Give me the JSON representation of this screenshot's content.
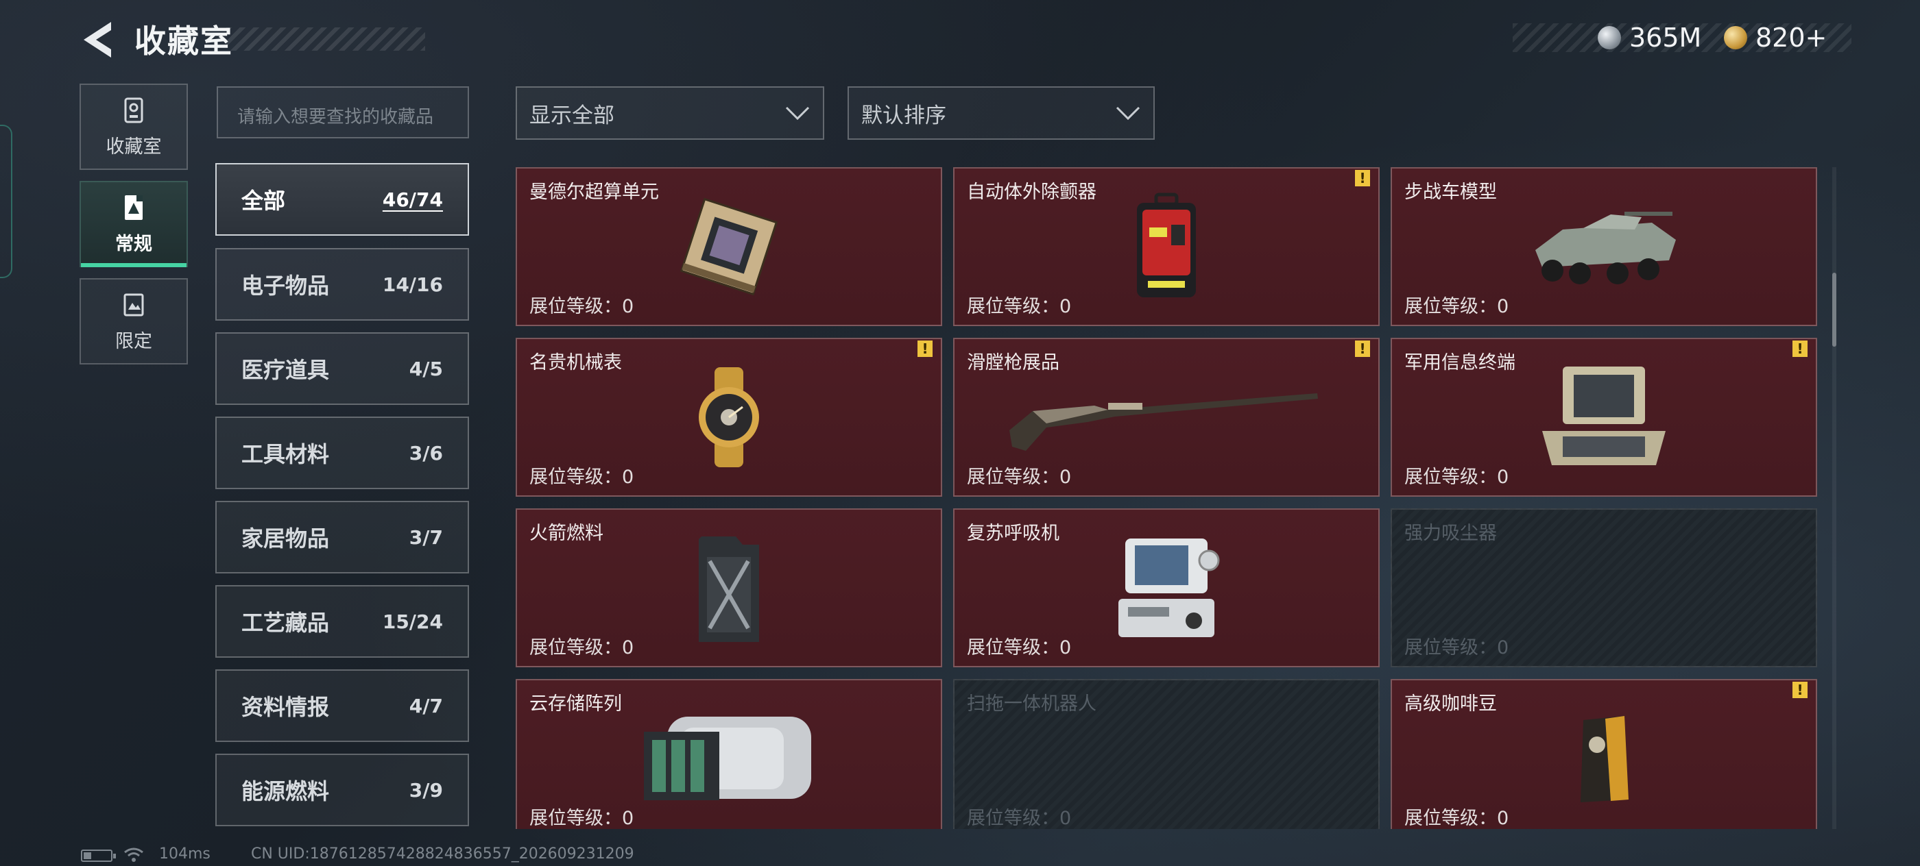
{
  "header": {
    "title": "收藏室",
    "currency": [
      {
        "icon": "silver-coin-icon",
        "value": "365M"
      },
      {
        "icon": "gold-coin-icon",
        "value": "820+"
      }
    ]
  },
  "side_tabs": [
    {
      "label": "收藏室",
      "icon": "collection-room-icon",
      "active": false
    },
    {
      "label": "常规",
      "icon": "regular-card-icon",
      "active": true
    },
    {
      "label": "限定",
      "icon": "limited-card-icon",
      "active": false
    }
  ],
  "search": {
    "placeholder": "请输入想要查找的收藏品"
  },
  "filters": {
    "display": "显示全部",
    "sort": "默认排序"
  },
  "categories": [
    {
      "name": "全部",
      "count": "46/74",
      "active": true
    },
    {
      "name": "电子物品",
      "count": "14/16"
    },
    {
      "name": "医疗道具",
      "count": "4/5"
    },
    {
      "name": "工具材料",
      "count": "3/6"
    },
    {
      "name": "家居物品",
      "count": "3/7"
    },
    {
      "name": "工艺藏品",
      "count": "15/24"
    },
    {
      "name": "资料情报",
      "count": "4/7"
    },
    {
      "name": "能源燃料",
      "count": "3/9"
    }
  ],
  "items": [
    {
      "name": "曼德尔超算单元",
      "level": "展位等级：0",
      "icon": "supercomputer-unit-icon",
      "owned": true,
      "alert": false
    },
    {
      "name": "自动体外除颤器",
      "level": "展位等级：0",
      "icon": "defibrillator-icon",
      "owned": true,
      "alert": true
    },
    {
      "name": "步战车模型",
      "level": "展位等级：0",
      "icon": "ifv-model-icon",
      "owned": true,
      "alert": false
    },
    {
      "name": "名贵机械表",
      "level": "展位等级：0",
      "icon": "watch-icon",
      "owned": true,
      "alert": true
    },
    {
      "name": "滑膛枪展品",
      "level": "展位等级：0",
      "icon": "musket-icon",
      "owned": true,
      "alert": true
    },
    {
      "name": "军用信息终端",
      "level": "展位等级：0",
      "icon": "military-terminal-icon",
      "owned": true,
      "alert": true
    },
    {
      "name": "火箭燃料",
      "level": "展位等级：0",
      "icon": "fuel-canister-icon",
      "owned": true,
      "alert": false
    },
    {
      "name": "复苏呼吸机",
      "level": "展位等级：0",
      "icon": "ventilator-icon",
      "owned": true,
      "alert": false
    },
    {
      "name": "强力吸尘器",
      "level": "展位等级：0",
      "icon": "vacuum-icon",
      "owned": false,
      "alert": false
    },
    {
      "name": "云存储阵列",
      "level": "展位等级：0",
      "icon": "storage-array-icon",
      "owned": true,
      "alert": false
    },
    {
      "name": "扫拖一体机器人",
      "level": "展位等级：0",
      "icon": "robot-vacuum-icon",
      "owned": false,
      "alert": false
    },
    {
      "name": "高级咖啡豆",
      "level": "展位等级：0",
      "icon": "coffee-bag-icon",
      "owned": true,
      "alert": true
    }
  ],
  "alert_mark": "!",
  "status_bar": {
    "ping": "104ms",
    "uid": "CN UID:187612857428824836557_202609231209",
    "battery_level": 0.3
  },
  "colors": {
    "accent": "#46d3a3",
    "card_owned": "#4d1d24",
    "alert": "#efc53e",
    "background": "#1d252e"
  }
}
